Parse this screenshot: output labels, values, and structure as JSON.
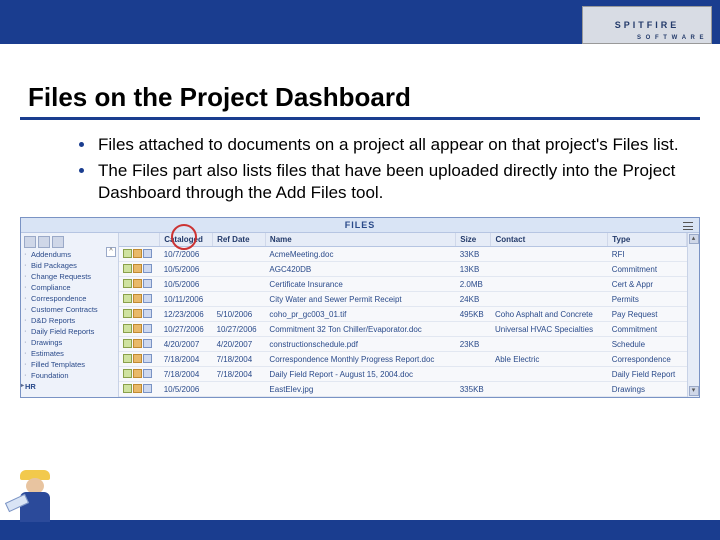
{
  "brand": {
    "name": "SPITFIRE",
    "sub": "S O F T W A R E"
  },
  "slide": {
    "title": "Files on the Project Dashboard",
    "bullets": [
      "Files attached to documents on a project all appear on that project's Files list.",
      "The Files part also lists files that have been uploaded directly into the Project Dashboard through the Add Files tool."
    ]
  },
  "files_part": {
    "header": "FILES",
    "sidebar": [
      "Addendums",
      "Bid Packages",
      "Change Requests",
      "Compliance",
      "Correspondence",
      "Customer Contracts",
      "D&D Reports",
      "Daily Field Reports",
      "Drawings",
      "Estimates",
      "Filled Templates",
      "Foundation"
    ],
    "sidebar_hr": "HR",
    "columns": [
      "",
      "Cataloged",
      "Ref Date",
      "Name",
      "Size",
      "Contact",
      "Type"
    ],
    "rows": [
      {
        "cataloged": "10/7/2006",
        "ref": "",
        "name": "AcmeMeeting.doc",
        "size": "33KB",
        "contact": "",
        "type": "RFI"
      },
      {
        "cataloged": "10/5/2006",
        "ref": "",
        "name": "AGC420DB",
        "size": "13KB",
        "contact": "",
        "type": "Commitment"
      },
      {
        "cataloged": "10/5/2006",
        "ref": "",
        "name": "Certificate Insurance",
        "size": "2.0MB",
        "contact": "",
        "type": "Cert & Appr"
      },
      {
        "cataloged": "10/11/2006",
        "ref": "",
        "name": "City Water and Sewer Permit Receipt",
        "size": "24KB",
        "contact": "",
        "type": "Permits"
      },
      {
        "cataloged": "12/23/2006",
        "ref": "5/10/2006",
        "name": "coho_pr_gc003_01.tif",
        "size": "495KB",
        "contact": "Coho Asphalt and Concrete",
        "type": "Pay Request"
      },
      {
        "cataloged": "10/27/2006",
        "ref": "10/27/2006",
        "name": "Commitment 32 Ton Chiller/Evaporator.doc",
        "size": "",
        "contact": "Universal HVAC Specialties",
        "type": "Commitment"
      },
      {
        "cataloged": "4/20/2007",
        "ref": "4/20/2007",
        "name": "constructionschedule.pdf",
        "size": "23KB",
        "contact": "",
        "type": "Schedule"
      },
      {
        "cataloged": "7/18/2004",
        "ref": "7/18/2004",
        "name": "Correspondence Monthly Progress Report.doc",
        "size": "",
        "contact": "Able Electric",
        "type": "Correspondence"
      },
      {
        "cataloged": "7/18/2004",
        "ref": "7/18/2004",
        "name": "Daily Field Report - August 15, 2004.doc",
        "size": "",
        "contact": "",
        "type": "Daily Field Report"
      },
      {
        "cataloged": "10/5/2006",
        "ref": "",
        "name": "EastElev.jpg",
        "size": "335KB",
        "contact": "",
        "type": "Drawings"
      }
    ]
  }
}
